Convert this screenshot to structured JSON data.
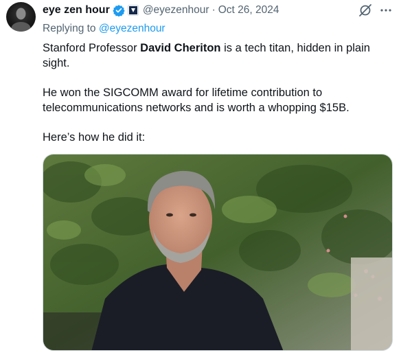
{
  "tweet": {
    "display_name": "eye zen hour",
    "handle": "@eyezenhour",
    "separator": "·",
    "date": "Oct 26, 2024",
    "replying_prefix": "Replying to ",
    "replying_to": "@eyezenhour",
    "text1_pre": "Stanford Professor ",
    "text1_bold": "David Cheriton",
    "text1_post": " is a tech titan, hidden in plain sight.",
    "text2": "He won the SIGCOMM award for lifetime contribution to telecommunications networks and is worth a whopping $15B.",
    "text3": "Here’s how he did it:"
  },
  "colors": {
    "text": "#0f1419",
    "secondary": "#536471",
    "accent": "#1d9bf0"
  },
  "icons": {
    "verified": "verified-badge-icon",
    "affiliate": "affiliate-badge-icon",
    "grok": "grok-icon",
    "more": "more-icon"
  }
}
